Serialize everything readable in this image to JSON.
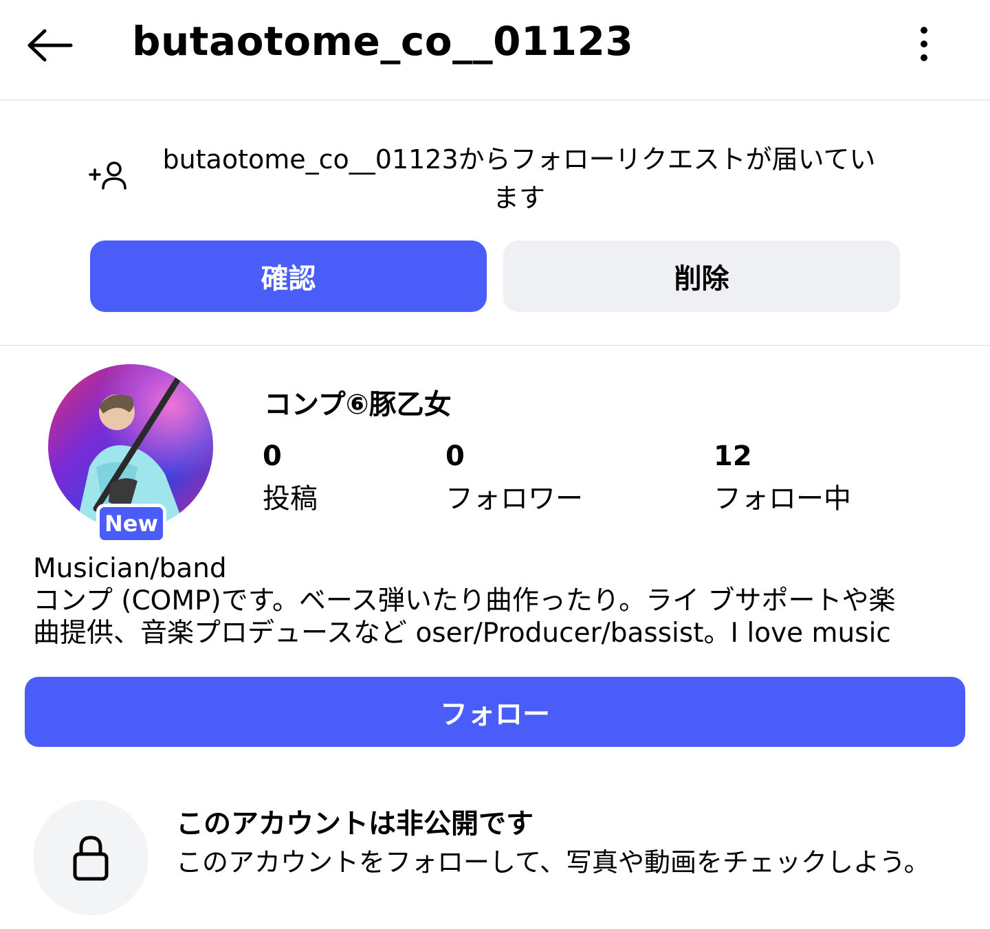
{
  "header": {
    "title": "butaotome_co__01123"
  },
  "follow_request": {
    "message_line1": "butaotome_co__01123からフォローリクエストが届いてい",
    "message_line2": "ます",
    "confirm_label": "確認",
    "delete_label": "削除"
  },
  "profile": {
    "new_badge": "New",
    "display_name": "コンプ⑥豚乙女",
    "stats": [
      {
        "value": "0",
        "label": "投稿"
      },
      {
        "value": "0",
        "label": "フォロワー"
      },
      {
        "value": "12",
        "label": "フォロー中"
      }
    ],
    "category": "Musician/band",
    "bio_line1": "コンプ (COMP)です。ベース弾いたり曲作ったり。ライ ブサポートや楽",
    "bio_line2": "曲提供、音楽プロデュースなど oser/Producer/bassist。I love music",
    "follow_label": "フォロー"
  },
  "private_notice": {
    "title": "このアカウントは非公開です",
    "description": "このアカウントをフォローして、写真や動画をチェックしよう。"
  },
  "colors": {
    "accent": "#4a5df9",
    "secondary_button": "#eff0f4",
    "divider": "#dbdbdb"
  },
  "icons": {
    "back": "arrow-left-icon",
    "more": "more-vertical-icon",
    "request": "add-person-icon",
    "lock": "lock-icon"
  }
}
